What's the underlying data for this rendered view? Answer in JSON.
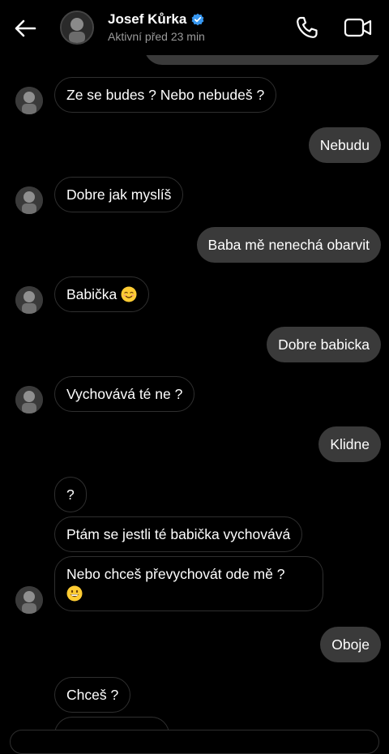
{
  "header": {
    "name": "Josef Kůrka",
    "status": "Aktivní před 23 min",
    "icons": {
      "back": "back-arrow-icon",
      "verified": "verified-badge-icon",
      "call": "phone-icon",
      "video": "video-camera-icon"
    },
    "verified_color": "#3797f0"
  },
  "messages": [
    {
      "side": "in",
      "text": "Ze se budes ? Nebo nebudeš ?"
    },
    {
      "side": "out",
      "text": "Nebudu"
    },
    {
      "side": "in",
      "text": "Dobre jak myslíš"
    },
    {
      "side": "out",
      "text": "Baba mě nenechá obarvit"
    },
    {
      "side": "in",
      "text": "Babička",
      "emoji": "smiling-face-emoji"
    },
    {
      "side": "out",
      "text": "Dobre babicka"
    },
    {
      "side": "in",
      "text": "Vychovává té ne ?"
    },
    {
      "side": "out",
      "text": "Klidne"
    },
    {
      "side": "in",
      "text": "?"
    },
    {
      "side": "in",
      "text": "Ptám se jestli té babička vychovává"
    },
    {
      "side": "in",
      "text": "Nebo chceš převychovát ode mě ?",
      "emoji": "grinning-face-emoji"
    },
    {
      "side": "out",
      "text": "Oboje"
    },
    {
      "side": "in",
      "text": "Chceš ?"
    }
  ],
  "colors": {
    "background": "#000000",
    "outgoing_bubble": "#3a3a3a",
    "incoming_border": "#2f2f2f",
    "status_text": "#9a9a9a"
  }
}
